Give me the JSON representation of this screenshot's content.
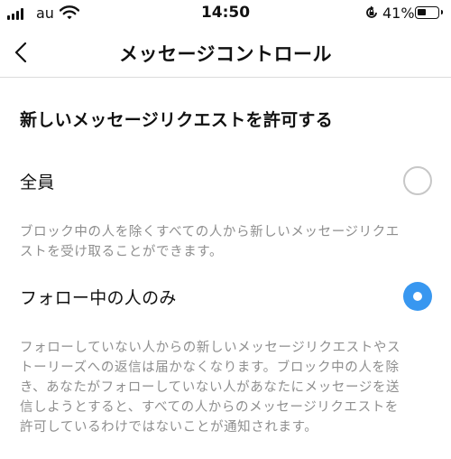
{
  "status_bar": {
    "carrier": "au",
    "time": "14:50",
    "battery_percent": "41%",
    "battery_level": 0.41,
    "icons": [
      "signal-icon",
      "wifi-icon",
      "orientation-lock-icon",
      "battery-icon"
    ]
  },
  "nav": {
    "back_icon": "chevron-left-icon",
    "title": "メッセージコントロール"
  },
  "section": {
    "title": "新しいメッセージリクエストを許可する"
  },
  "options": [
    {
      "label": "全員",
      "selected": false,
      "description_lines": [
        "ブロック中の人を除くすべての人から新しいメッセージリクエ",
        "ストを受け取ることができます。"
      ]
    },
    {
      "label": "フォロー中の人のみ",
      "selected": true,
      "description_lines": [
        "フォローしていない人からの新しいメッセージリクエストやス",
        "トーリーズへの返信は届かなくなります。ブロック中の人を除",
        "き、あなたがフォローしていない人があなたにメッセージを送",
        "信しようとすると、すべての人からのメッセージリクエストを",
        "許可しているわけではないことが通知されます。"
      ]
    }
  ],
  "colors": {
    "accent": "#3897f0",
    "secondary_text": "#8e8e8e",
    "divider": "#dbdbdb"
  }
}
